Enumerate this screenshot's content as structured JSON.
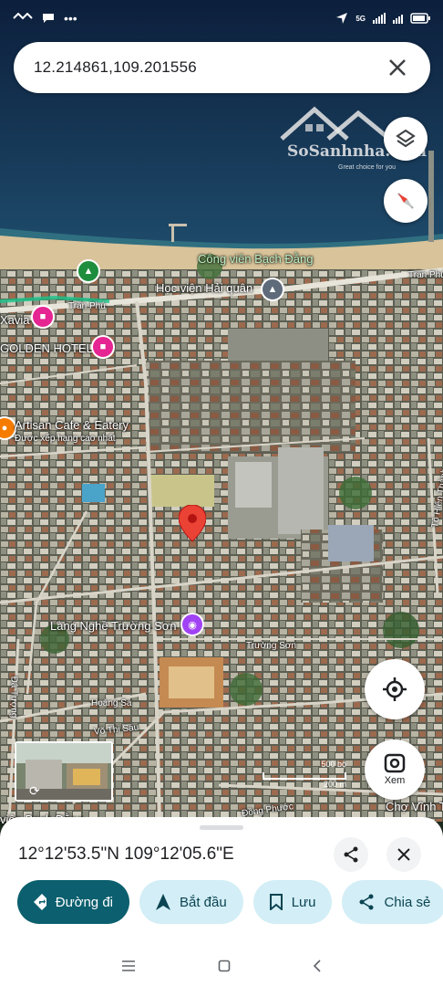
{
  "status_bar": {
    "network": "5G",
    "icons": [
      "notification-dot-icon",
      "chat-icon",
      "more-dots-icon",
      "location-arrow-icon",
      "signal-icon",
      "signal-icon-2",
      "battery-icon"
    ]
  },
  "search": {
    "value": "12.214861,109.201556",
    "close_icon": "close-icon"
  },
  "watermark": {
    "brand": "SoSanhnha.com",
    "tagline": "Great choice for you"
  },
  "map": {
    "labels": {
      "park": "Công viên Bạch Đằng",
      "naval_academy": "Học viện Hải quân",
      "tran_phu_1": "Trần Phú",
      "tran_phu_2": "Trần Phú",
      "xavia": "Xavia",
      "golden_hotel": "GOLDEN HOTEL",
      "artisan": "Artisan Cafe & Eatery",
      "artisan_sub": "Được xếp hạng cao nhất",
      "lang_nghe": "Làng Nghề Trường Sơn",
      "truong_son": "Trường Sơn",
      "hoang_sa": "Hoàng Sa",
      "vo_thi_sau": "Võ Thị Sáu",
      "da_tuong": "Đá Tượng",
      "to_hien": "Tô Hiến Thành",
      "dong_phuoc": "Đồng Phước",
      "cho_vinh_tr": "Chợ Vĩnh Tr",
      "viem_bottom": "viên Bạch Đằng"
    },
    "scale": {
      "top": "500 bộ",
      "bottom": "200 m"
    },
    "layers_icon": "layers-icon",
    "compass_icon": "compass-icon",
    "locate_icon": "my-location-icon",
    "lens_label": "Xem",
    "pin_color": "#ea4335"
  },
  "sheet": {
    "title": "12°12'53.5\"N 109°12'05.6\"E",
    "share_icon": "share-icon",
    "close_icon": "close-icon",
    "actions": [
      {
        "label": "Đường đi",
        "icon": "directions-icon"
      },
      {
        "label": "Bắt đầu",
        "icon": "navigation-icon"
      },
      {
        "label": "Lưu",
        "icon": "bookmark-icon"
      },
      {
        "label": "Chia sẻ",
        "icon": "share-icon"
      }
    ]
  },
  "colors": {
    "primary": "#0b5f6e",
    "secondary": "#d3eef6",
    "sea": "#0f2a4d"
  }
}
